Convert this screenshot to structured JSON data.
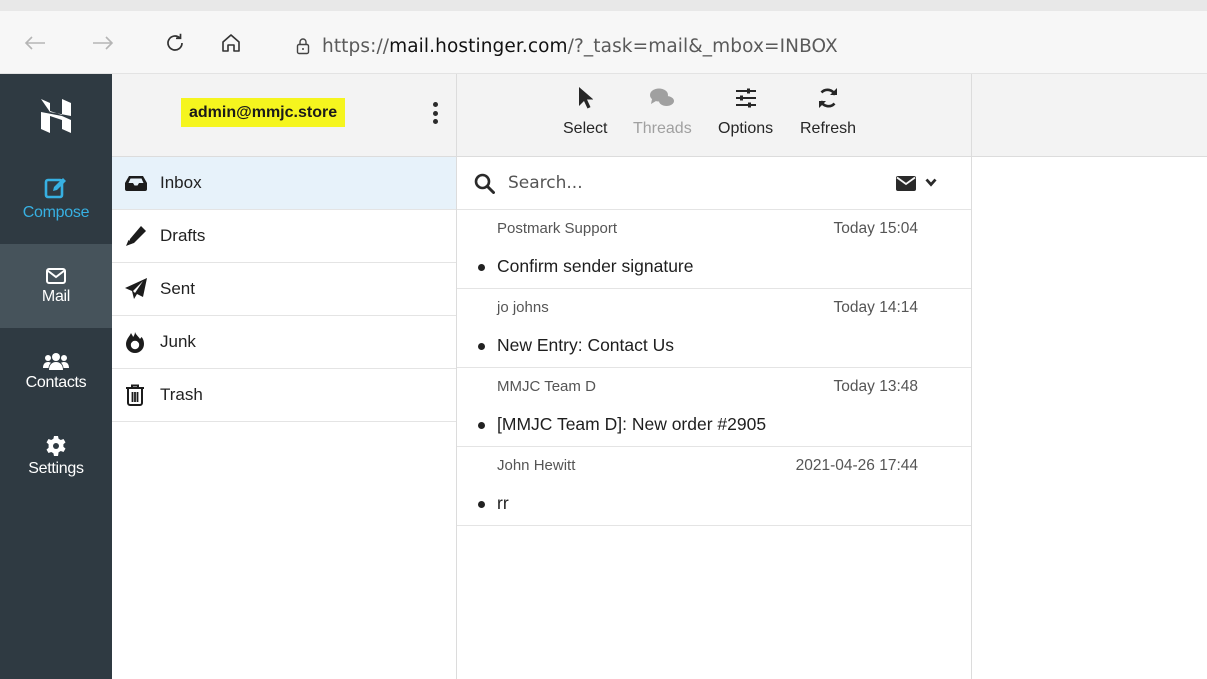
{
  "browser": {
    "url_prefix": "https://",
    "url_host": "mail.hostinger.com",
    "url_rest": "/?_task=mail&_mbox=INBOX"
  },
  "sidebar": {
    "items": [
      {
        "label": "Compose",
        "icon": "compose-icon"
      },
      {
        "label": "Mail",
        "icon": "envelope-icon"
      },
      {
        "label": "Contacts",
        "icon": "users-icon"
      },
      {
        "label": "Settings",
        "icon": "gear-icon"
      }
    ]
  },
  "account": "admin@mmjc.store",
  "folders": [
    {
      "label": "Inbox",
      "icon": "inbox-icon"
    },
    {
      "label": "Drafts",
      "icon": "pencil-icon"
    },
    {
      "label": "Sent",
      "icon": "paper-plane-icon"
    },
    {
      "label": "Junk",
      "icon": "fire-icon"
    },
    {
      "label": "Trash",
      "icon": "trash-icon"
    }
  ],
  "toolbar": {
    "select": "Select",
    "threads": "Threads",
    "options": "Options",
    "refresh": "Refresh"
  },
  "search": {
    "placeholder": "Search..."
  },
  "messages": [
    {
      "from": "Postmark Support",
      "date": "Today 15:04",
      "subject": "Confirm sender signature"
    },
    {
      "from": "jo johns",
      "date": "Today 14:14",
      "subject": "New Entry: Contact Us"
    },
    {
      "from": "MMJC Team D",
      "date": "Today 13:48",
      "subject": "[MMJC Team D]: New order #2905"
    },
    {
      "from": "John Hewitt",
      "date": "2021-04-26 17:44",
      "subject": "rr"
    }
  ],
  "colors": {
    "sidebar": "#2f3a42",
    "sidebar_active": "#46535b",
    "compose_accent": "#37b0e2",
    "account_highlight": "#f5f51e",
    "selected_folder": "#e7f2fa"
  }
}
